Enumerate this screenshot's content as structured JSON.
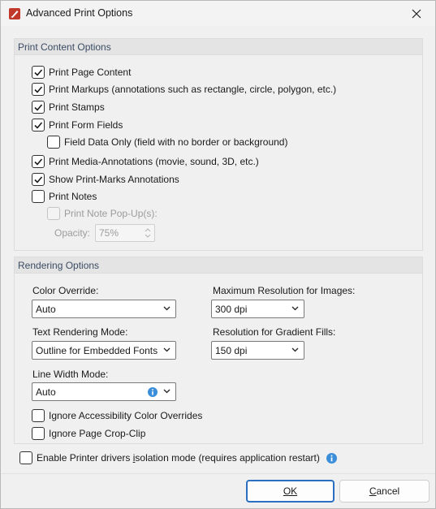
{
  "window": {
    "title": "Advanced Print Options"
  },
  "print_content": {
    "header": "Print Content Options",
    "items": [
      {
        "label": "Print Page Content",
        "checked": true
      },
      {
        "label": "Print Markups (annotations such as rectangle, circle, polygon, etc.)",
        "checked": true
      },
      {
        "label": "Print Stamps",
        "checked": true
      },
      {
        "label": "Print Form Fields",
        "checked": true
      },
      {
        "label": "Field Data Only (field with no border or background)",
        "checked": false
      },
      {
        "label": "Print Media-Annotations (movie, sound, 3D, etc.)",
        "checked": true
      },
      {
        "label": "Show Print-Marks Annotations",
        "checked": true
      },
      {
        "label": "Print Notes",
        "checked": false
      },
      {
        "label": "Print Note Pop-Up(s):",
        "checked": false,
        "disabled": true
      }
    ],
    "opacity_label": "Opacity:",
    "opacity_value": "75%"
  },
  "rendering": {
    "header": "Rendering Options",
    "color_override": {
      "label": "Color Override:",
      "value": "Auto"
    },
    "max_resolution": {
      "label": "Maximum Resolution for Images:",
      "value": "300 dpi"
    },
    "text_rendering": {
      "label": "Text Rendering Mode:",
      "value": "Outline for Embedded Fonts"
    },
    "gradient_resolution": {
      "label": "Resolution for Gradient Fills:",
      "value": "150 dpi"
    },
    "line_width": {
      "label": "Line Width Mode:",
      "value": "Auto"
    },
    "ignore_accessibility": {
      "label": "Ignore Accessibility Color Overrides",
      "checked": false
    },
    "ignore_crop": {
      "label": "Ignore Page Crop-Clip",
      "checked": false
    }
  },
  "isolation": {
    "label_pre": "Enable Printer drivers ",
    "label_u": "i",
    "label_post": "solation mode (requires application restart)",
    "checked": false
  },
  "buttons": {
    "ok": "OK",
    "cancel_u": "C",
    "cancel_rest": "ancel"
  },
  "colors": {
    "accent": "#2b6fc2",
    "info": "#3b8ed9",
    "icon_red": "#c0392b"
  }
}
